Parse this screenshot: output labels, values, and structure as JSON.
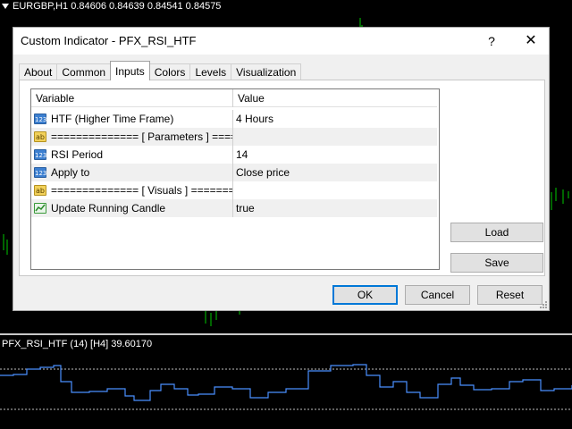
{
  "chart": {
    "symbol_info": "EURGBP,H1  0.84606 0.84639 0.84541 0.84575",
    "indicator_line": "PFX_RSI_HTF (14) [H4] 39.60170",
    "colors": {
      "candles": "#00c800",
      "rsi_line": "#4a90ff",
      "level_lines": "#c0c0c0"
    }
  },
  "dialog": {
    "title": "Custom Indicator - PFX_RSI_HTF",
    "help_glyph": "?",
    "close_glyph": "✕",
    "tabs": [
      {
        "label": "About",
        "active": false
      },
      {
        "label": "Common",
        "active": false
      },
      {
        "label": "Inputs",
        "active": true
      },
      {
        "label": "Colors",
        "active": false
      },
      {
        "label": "Levels",
        "active": false
      },
      {
        "label": "Visualization",
        "active": false
      }
    ],
    "table": {
      "headers": {
        "variable": "Variable",
        "value": "Value"
      },
      "rows": [
        {
          "icon": "numeric-icon",
          "icon_text": "123",
          "variable": "HTF (Higher Time Frame)",
          "value": "4 Hours"
        },
        {
          "icon": "string-icon",
          "icon_text": "ab",
          "variable": "============== [ Parameters ] ======...",
          "value": ""
        },
        {
          "icon": "numeric-icon",
          "icon_text": "123",
          "variable": "RSI Period",
          "value": "14"
        },
        {
          "icon": "numeric-icon",
          "icon_text": "123",
          "variable": "Apply to",
          "value": "Close price"
        },
        {
          "icon": "string-icon",
          "icon_text": "ab",
          "variable": "============== [ Visuals ] =========...",
          "value": ""
        },
        {
          "icon": "bool-icon",
          "icon_text": "",
          "variable": "Update Running Candle",
          "value": "true"
        }
      ]
    },
    "buttons": {
      "load": "Load",
      "save": "Save",
      "ok": "OK",
      "cancel": "Cancel",
      "reset": "Reset"
    }
  }
}
